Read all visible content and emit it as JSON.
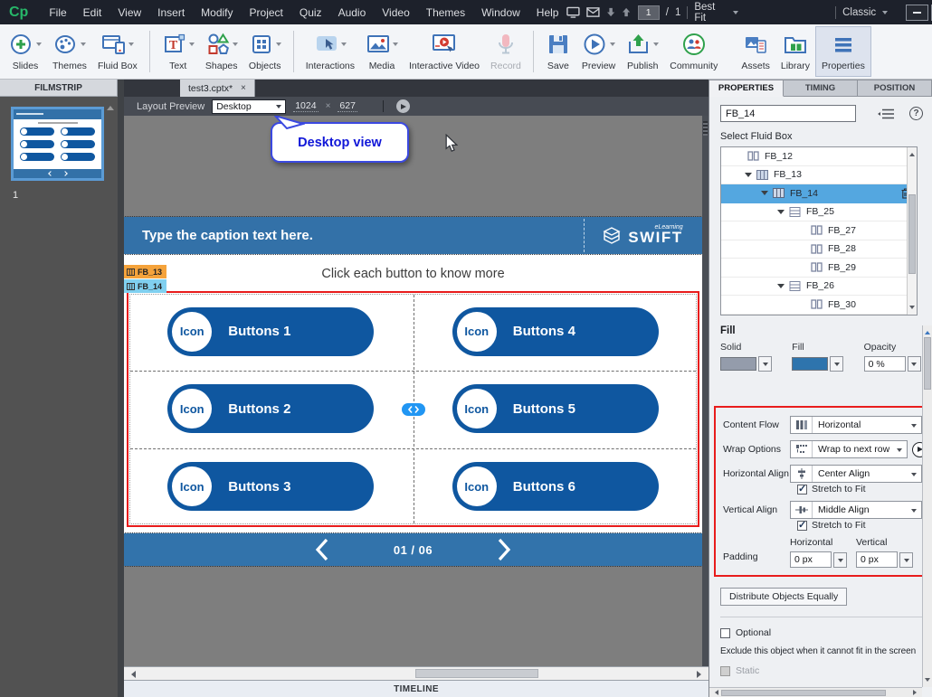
{
  "menubar": {
    "logo": "Cp",
    "items": [
      "File",
      "Edit",
      "View",
      "Insert",
      "Modify",
      "Project",
      "Quiz",
      "Audio",
      "Video",
      "Themes",
      "Window",
      "Help"
    ],
    "slide_current": "1",
    "slide_of_glyph": "/",
    "slide_total": "1",
    "zoom": "Best Fit",
    "workspace": "Classic",
    "close_glyph": "✕"
  },
  "toolbar": {
    "items": [
      "Slides",
      "Themes",
      "Fluid Box",
      "Text",
      "Shapes",
      "Objects",
      "Interactions",
      "Media",
      "Interactive Video",
      "Record",
      "Save",
      "Preview",
      "Publish",
      "Community",
      "Assets",
      "Library",
      "Properties"
    ]
  },
  "filmstrip": {
    "header": "FILMSTRIP",
    "slide_number": "1"
  },
  "tabbar": {
    "document_tab": "test3.cptx*",
    "close_glyph": "×"
  },
  "layoutbar": {
    "label": "Layout Preview",
    "device": "Desktop",
    "canvas_width": "1024",
    "times_glyph": "×",
    "canvas_height": "627"
  },
  "callout": {
    "text": "Desktop view"
  },
  "slide": {
    "caption": "Type the caption text here.",
    "logo_tagline": "eLearning",
    "logo_brand": "SWIFT",
    "fluid_box_tags": [
      "FB_13",
      "FB_14"
    ],
    "heading": "Click each button to know more",
    "icon_label": "Icon",
    "buttons": [
      "Buttons 1",
      "Buttons 2",
      "Buttons 3",
      "Buttons 4",
      "Buttons 5",
      "Buttons 6"
    ],
    "pagination": "01 / 06"
  },
  "canvas": {
    "timeline_label": "TIMELINE"
  },
  "properties": {
    "tabs": [
      "PROPERTIES",
      "TIMING",
      "POSITION"
    ],
    "name_value": "FB_14",
    "help_glyph": "?",
    "select_fluid_box_label": "Select Fluid Box",
    "tree": [
      "FB_12",
      "FB_13",
      "FB_14",
      "FB_25",
      "FB_27",
      "FB_28",
      "FB_29",
      "FB_26",
      "FB_30"
    ],
    "fill": {
      "header": "Fill",
      "solid_label": "Solid",
      "fill_label": "Fill",
      "opacity_label": "Opacity",
      "opacity_value": "0 %"
    },
    "layout": {
      "content_flow_label": "Content Flow",
      "content_flow_value": "Horizontal",
      "wrap_label": "Wrap Options",
      "wrap_value": "Wrap to next row",
      "horizontal_align_label": "Horizontal Align",
      "horizontal_align_value": "Center Align",
      "vertical_align_label": "Vertical Align",
      "vertical_align_value": "Middle Align",
      "stretch_label": "Stretch to Fit",
      "padding_label": "Padding",
      "padding_horizontal_label": "Horizontal",
      "padding_vertical_label": "Vertical",
      "padding_horizontal_value": "0 px",
      "padding_vertical_value": "0 px"
    },
    "distribute_button": "Distribute Objects Equally",
    "optional_label": "Optional",
    "exclude_note": "Exclude this object when it cannot fit in the screen",
    "static_label": "Static"
  },
  "colors": {
    "caption_blue": "#3371a8",
    "button_blue": "#0f57a0",
    "pager_blue": "#3273ab",
    "annotation_red": "#e81c1c",
    "selection_blue": "#54a7e0",
    "fb13_tag_orange": "#f5a33b",
    "fb14_tag_cyan": "#80d0f0",
    "fill_swatch": "#2e74ad",
    "solid_swatch": "#949cab"
  }
}
